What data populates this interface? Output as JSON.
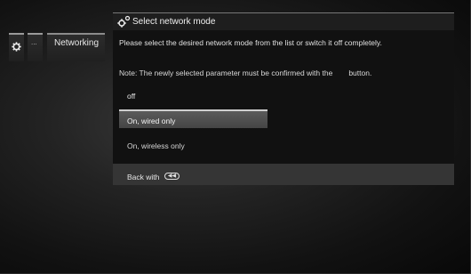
{
  "menu": {
    "tabs": [
      {
        "icon": "gear-icon",
        "label": ""
      },
      {
        "label": "..."
      },
      {
        "label": "Networking"
      }
    ]
  },
  "dialog": {
    "title": "Select network mode",
    "title_icon": "gear-icon",
    "description": "Please select the desired network mode from the list or switch it off completely.",
    "note_before": "Note: The newly selected parameter must be confirmed with the",
    "note_after": "button.",
    "options": [
      {
        "label": "off",
        "selected": false
      },
      {
        "label": "On, wired only",
        "selected": true
      },
      {
        "label": "On, wireless only",
        "selected": false
      }
    ],
    "back_label": "Back with",
    "back_icon": "back-button-icon",
    "back_icon_glyph": "◀◀"
  }
}
